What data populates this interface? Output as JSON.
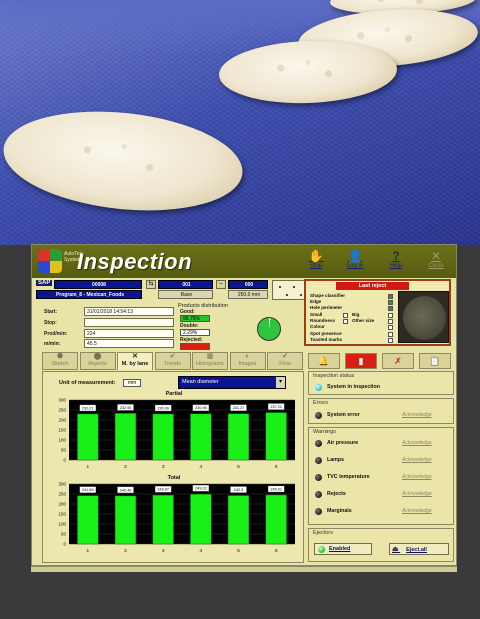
{
  "window": {
    "brand": "AutoTec Systems",
    "title": "Inspection",
    "buttons": {
      "stop": "Stop",
      "login": "Log in",
      "help": "Help",
      "close": "Close"
    }
  },
  "header": {
    "sap_label": "SAP",
    "sap_value": "00008",
    "program": "Program_8 - Mexican_Foods",
    "lanes_value": "001",
    "base_label": "Base",
    "size_value": "000",
    "size_unit": "250.0 mm"
  },
  "run_info": {
    "start_label": "Start:",
    "start_value": "31/01/2018 14:54:13",
    "stop_label": "Stop:",
    "stop_value": "",
    "prod_label": "Prod/min:",
    "prod_value": "224",
    "speed_label": "m/min:",
    "speed_value": "45.5"
  },
  "distribution": {
    "title": "Products distribution",
    "good_label": "Good:",
    "good_value": "95.76%",
    "double_label": "Double:",
    "double_value": "2.29%",
    "rejected_label": "Rejected:",
    "rejected_value": "1.95%"
  },
  "last_reject": {
    "title": "Last reject",
    "checks": [
      {
        "label": "Shape classifier",
        "checked": true
      },
      {
        "label": "Edge",
        "checked": true
      },
      {
        "label": "Hole perimeter",
        "checked": true
      },
      {
        "label": "Small",
        "checked": false
      },
      {
        "label": "Big",
        "checked": false
      },
      {
        "label": "Roundness",
        "checked": false
      },
      {
        "label": "Other size",
        "checked": false
      },
      {
        "label": "Colour",
        "checked": false
      },
      {
        "label": "Spot presence",
        "checked": false
      },
      {
        "label": "Toasted marks",
        "checked": false
      }
    ]
  },
  "tabs": [
    {
      "label": "Sketch",
      "icon": "sketch-icon",
      "active": false
    },
    {
      "label": "Rejects",
      "icon": "rejects-icon",
      "active": false
    },
    {
      "label": "M. by lane",
      "icon": "lanes-icon",
      "active": true
    },
    {
      "label": "Trends",
      "icon": "trends-icon",
      "active": false
    },
    {
      "label": "Histograms",
      "icon": "histogram-icon",
      "active": false
    },
    {
      "label": "Images",
      "icon": "images-icon",
      "active": false
    },
    {
      "label": "Flow",
      "icon": "flow-icon",
      "active": false
    }
  ],
  "content": {
    "unit_label": "Unit of measurement:",
    "unit_value": "mm",
    "metric": "Mean diameter",
    "partial_title": "Partial",
    "total_title": "Total"
  },
  "chart_data": [
    {
      "type": "bar",
      "title": "Partial",
      "categories": [
        "1",
        "2",
        "3",
        "4",
        "5",
        "6"
      ],
      "values": [
        230.21,
        232.95,
        230.06,
        230.98,
        231.27,
        237.22
      ],
      "ylim": [
        0,
        300
      ],
      "yticks": [
        0,
        50,
        100,
        150,
        200,
        250,
        300
      ],
      "bar_color": "#18f018"
    },
    {
      "type": "bar",
      "title": "Total",
      "categories": [
        "1",
        "2",
        "3",
        "4",
        "5",
        "6"
      ],
      "values": [
        241.69,
        240.49,
        243.97,
        249.02,
        242.3,
        245.01
      ],
      "ylim": [
        0,
        300
      ],
      "yticks": [
        0,
        50,
        100,
        150,
        200,
        250,
        300
      ],
      "bar_color": "#18f018"
    }
  ],
  "status": {
    "inspection_title": "Inspection status",
    "inspection_value": "System in inspection",
    "errors_title": "Errors",
    "system_error": "System error",
    "warnings_title": "Warnings",
    "warnings": [
      "Air pressure",
      "Lamps",
      "TVC temperature",
      "Rejects",
      "Marginals"
    ],
    "acknowledge": "Acknowledge",
    "ejectors_title": "Ejectors",
    "enabled": "Enabled",
    "eject_all": "Eject.all"
  },
  "colors": {
    "panel": "#e8e3a6",
    "titlebar": "#5f6514",
    "accent_blue": "#0c1590",
    "reject_red": "#d11b12",
    "bar_green": "#18f018"
  }
}
